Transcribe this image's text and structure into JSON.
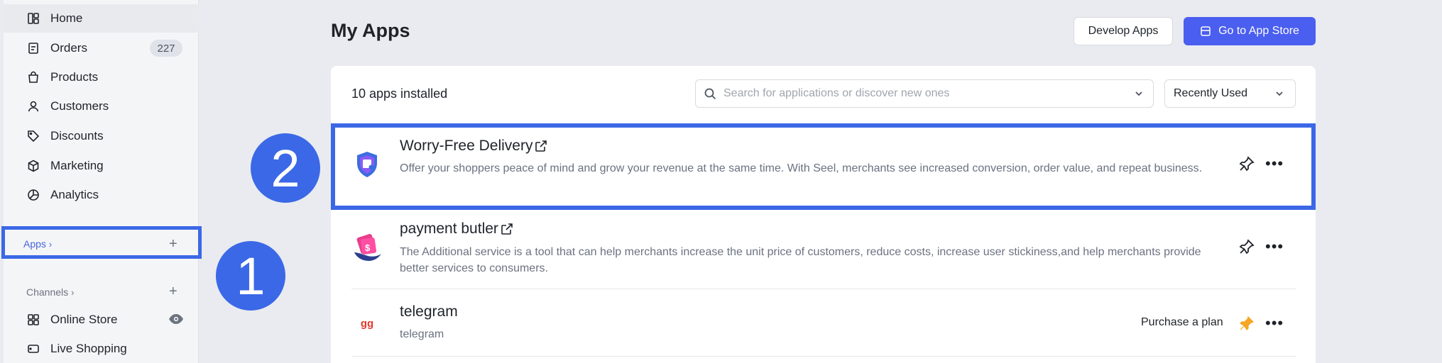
{
  "sidebar": {
    "items": [
      {
        "label": "Home",
        "icon": "layout-icon"
      },
      {
        "label": "Orders",
        "icon": "document-icon",
        "badge": "227"
      },
      {
        "label": "Products",
        "icon": "bag-icon"
      },
      {
        "label": "Customers",
        "icon": "person-icon"
      },
      {
        "label": "Discounts",
        "icon": "tag-icon"
      },
      {
        "label": "Marketing",
        "icon": "cube-icon"
      },
      {
        "label": "Analytics",
        "icon": "pie-chart-icon"
      }
    ],
    "apps_section": "Apps",
    "channels_section": "Channels",
    "channels": [
      {
        "label": "Online Store",
        "icon": "grid-icon"
      },
      {
        "label": "Live Shopping",
        "icon": "video-icon"
      }
    ]
  },
  "header": {
    "title": "My Apps",
    "develop_button": "Develop Apps",
    "store_button": "Go to App Store"
  },
  "toolbar": {
    "installed_count": "10 apps installed",
    "search_placeholder": "Search for applications or discover new ones",
    "sort_value": "Recently Used"
  },
  "apps": [
    {
      "name": "Worry-Free Delivery",
      "description": "Offer your shoppers peace of mind and grow your revenue at the same time. With Seel, merchants see increased conversion, order value, and repeat business.",
      "icon": "shield-icon"
    },
    {
      "name": "payment butler",
      "description": "The Additional service is a tool that can help merchants increase the unit price of customers, reduce costs, increase user stickiness,and help merchants provide better services to consumers.",
      "icon": "payment-icon"
    },
    {
      "name": "telegram",
      "description": "telegram",
      "icon_text": "gg",
      "action": "Purchase a plan"
    }
  ],
  "callouts": [
    "1",
    "2"
  ],
  "colors": {
    "accent": "#4a5ef0",
    "highlight": "#3b68e6",
    "pinned": "#f5a623"
  }
}
